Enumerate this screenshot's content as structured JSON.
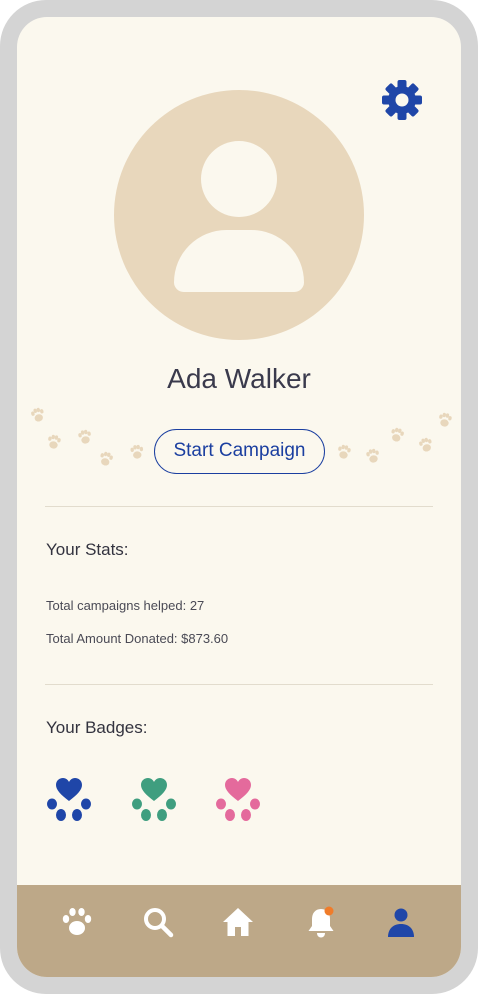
{
  "profile": {
    "name": "Ada Walker",
    "start_campaign_label": "Start Campaign"
  },
  "stats": {
    "title": "Your Stats:",
    "campaigns_helped": "Total campaigns helped: 27",
    "amount_donated": "Total Amount Donated: $873.60"
  },
  "badges": {
    "title": "Your Badges:",
    "items": [
      {
        "icon": "paw-heart-icon",
        "color": "#1f46a8"
      },
      {
        "icon": "paw-heart-icon",
        "color": "#3f9e7f"
      },
      {
        "icon": "paw-heart-icon",
        "color": "#e46a9c"
      }
    ]
  },
  "nav": {
    "items": [
      {
        "icon": "paw-icon",
        "active": false
      },
      {
        "icon": "search-icon",
        "active": false
      },
      {
        "icon": "home-icon",
        "active": false
      },
      {
        "icon": "bell-icon",
        "active": false,
        "notification_dot": true
      },
      {
        "icon": "profile-icon",
        "active": true
      }
    ]
  },
  "colors": {
    "accent": "#1b3fa0",
    "background": "#fbf8ee",
    "nav_background": "#bda888",
    "avatar": "#e8d7bc",
    "notification": "#f07c2a"
  }
}
